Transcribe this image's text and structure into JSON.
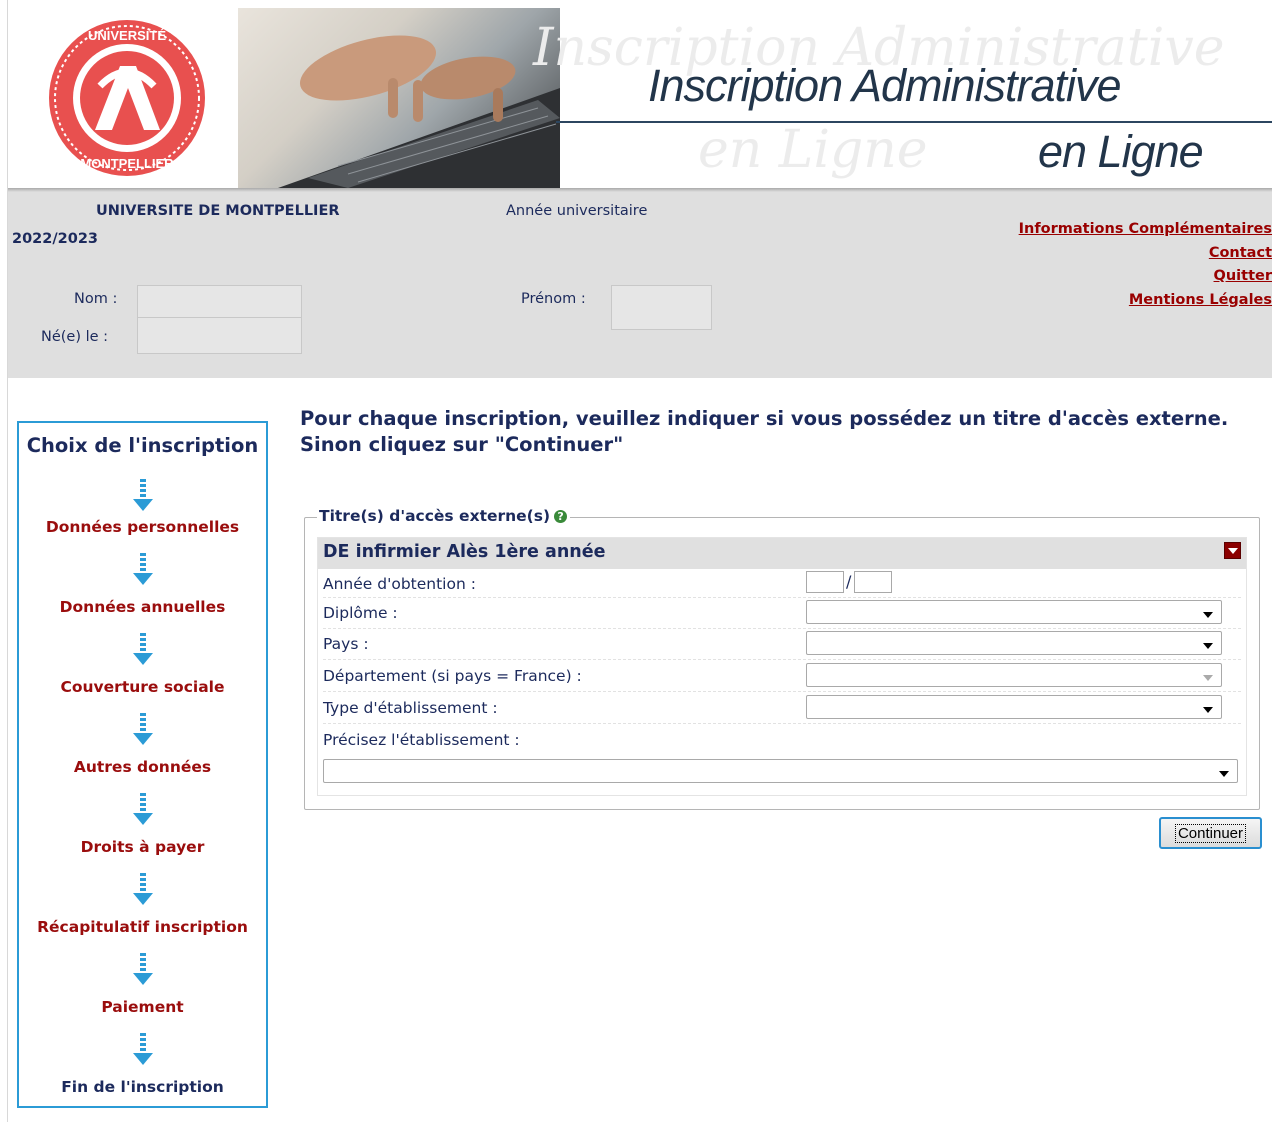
{
  "header": {
    "title_line1": "Inscription Administrative",
    "title_line2": "en Ligne",
    "logo_text_top": "UNIVERSITÉ",
    "logo_text_bottom": "MONTPELLIER"
  },
  "info": {
    "university": "UNIVERSITE DE MONTPELLIER",
    "year_label": "Année universitaire",
    "year": "2022/2023",
    "nom_label": "Nom :",
    "prenom_label": "Prénom :",
    "naissance_label": "Né(e) le :",
    "links": [
      "Informations Complémentaires",
      "Contact",
      "Quitter",
      "Mentions Légales"
    ]
  },
  "nav": {
    "title": "Choix de l'inscription",
    "items": [
      "Données personnelles",
      "Données annuelles",
      "Couverture sociale",
      "Autres données",
      "Droits à payer",
      "Récapitulatif inscription",
      "Paiement",
      "Fin de l'inscription"
    ]
  },
  "main": {
    "headline_line1": "Pour chaque inscription, veuillez indiquer si vous possédez un titre d'accès externe.",
    "headline_line2": "Sinon cliquez sur \"Continuer\"",
    "legend": "Titre(s) d'accès externe(s)",
    "section_title": "DE infirmier Alès 1ère année",
    "fields": {
      "annee": "Année d'obtention :",
      "diplome": "Diplôme :",
      "pays": "Pays :",
      "departement": "Département (si pays = France) :",
      "type": "Type d'établissement :",
      "etablissement": "Précisez l'établissement :"
    },
    "continue_label": "Continuer"
  },
  "colors": {
    "navy": "#1c2a5c",
    "nav_red": "#9a0d0d",
    "link_red": "#990000",
    "accent_blue": "#2b9bd6",
    "info_grey": "#dfdfdf"
  }
}
